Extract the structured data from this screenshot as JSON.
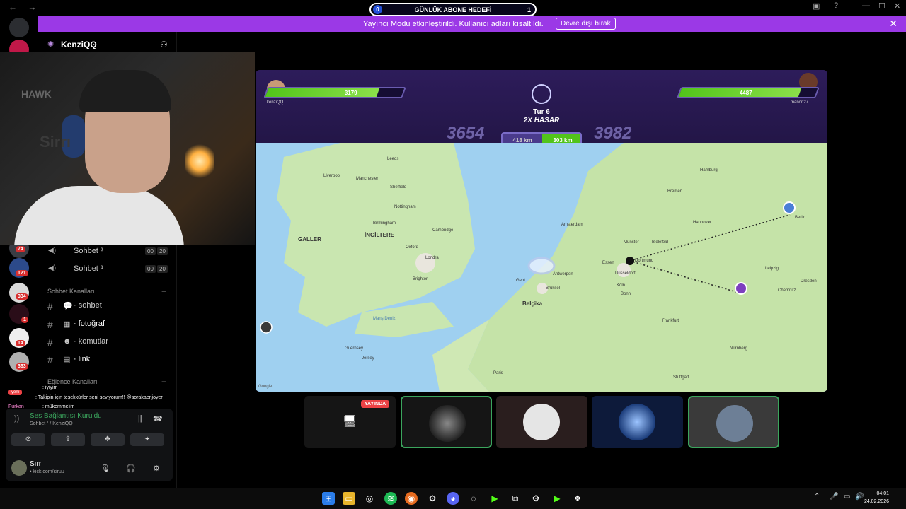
{
  "goal": {
    "label": "GÜNLÜK ABONE HEDEFİ",
    "current": "0",
    "target": "1"
  },
  "banner": {
    "text": "Yayıncı Modu etkinleştirildi. Kullanıcı adları kısaltıldı.",
    "button": "Devre dışı bırak"
  },
  "server": {
    "name": "KenziQQ"
  },
  "rail": {
    "badges": [
      "74",
      "121",
      "334",
      "1",
      "14",
      "363"
    ]
  },
  "voice_channels": [
    {
      "label": "Sohbet ²",
      "count": "00",
      "limit": "20"
    },
    {
      "label": "Sohbet ³",
      "count": "00",
      "limit": "20"
    }
  ],
  "categories": {
    "chat": "Sohbet Kanalları",
    "fun": "Eğlence Kanalları"
  },
  "text_channels": [
    "· sohbet",
    "· fotoğraf",
    "· komutlar",
    "· link"
  ],
  "chat_overlay": [
    {
      "user": "",
      "text": ": iyiyim"
    },
    {
      "user": "",
      "text": ": Takipin için teşekkürler seni seviyorum!! @sorakaenjoyer"
    },
    {
      "user": "Furkan",
      "text": ": mükemmelim"
    }
  ],
  "webcam": {
    "brand": "HAWK",
    "tag": "Sirrı"
  },
  "game": {
    "left_player": {
      "name": "kenziQQ",
      "hp": "3179",
      "hp_fraction": 0.82
    },
    "right_player": {
      "name": "manon27",
      "hp": "4487",
      "hp_fraction": 0.88
    },
    "round": "Tur 6",
    "multiplier": "2X HASAR",
    "left_score": "3654",
    "right_score": "3982",
    "left_distance": "418 km",
    "right_distance": "303 km"
  },
  "map": {
    "countries": [
      "İNGİLTERE",
      "GALLER",
      "Belçika"
    ],
    "cities": [
      "Leeds",
      "Liverpool",
      "Manchester",
      "Sheffield",
      "Nottingham",
      "Birmingham",
      "Cambridge",
      "Oxford",
      "Londra",
      "Brighton",
      "Amsterdam",
      "Gent",
      "Brüksel",
      "Antwerpen",
      "Essen",
      "Dortmund",
      "Düsseldorf",
      "Köln",
      "Bonn",
      "Frankfurt",
      "Hamburg",
      "Bremen",
      "Hannover",
      "Bielefeld",
      "Münster",
      "Leipzig",
      "Dresden",
      "Chemnitz",
      "Nürnberg",
      "Stuttgart",
      "Paris",
      "Guernsey",
      "Jersey",
      "Berlin"
    ],
    "sea": "Manş Denizi",
    "credit": "Google"
  },
  "stage": {
    "live": "YAYINDA"
  },
  "voice": {
    "status": "Ses Bağlantısı Kuruldu",
    "channel": "Sohbet ¹ / KenziQQ"
  },
  "user": {
    "name": "Sırrı",
    "status": "• kick.com/siruu"
  },
  "clock": {
    "time": "04:01",
    "date": "24.02.2026"
  },
  "colors": {
    "accent": "#9b39e6",
    "green": "#3ba55d",
    "live": "#ed4245"
  }
}
